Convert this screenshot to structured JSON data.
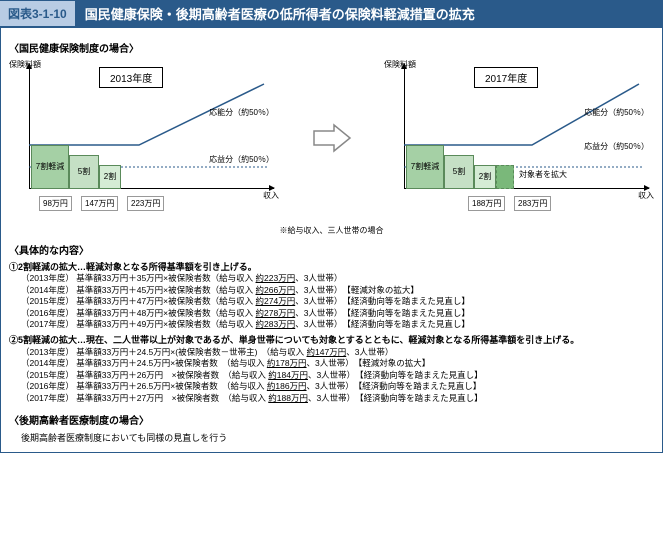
{
  "header": {
    "figNum": "図表3-1-10",
    "title": "国民健康保険・後期高齢者医療の低所得者の保険料軽減措置の拡充"
  },
  "section1": "〈国民健康保険制度の場合〉",
  "footnote": "※給与収入、三人世帯の場合",
  "chart_data": [
    {
      "type": "bar",
      "year": "2013年度",
      "ylabel": "保険料額",
      "xlabel": "収入",
      "notes": {
        "oneibun": "応能分（約50％）",
        "ouekibun": "応益分（約50％）"
      },
      "bars": [
        {
          "label": "7割軽減",
          "threshold": "98万円"
        },
        {
          "label": "5割",
          "threshold": "147万円"
        },
        {
          "label": "2割",
          "threshold": "223万円"
        }
      ]
    },
    {
      "type": "bar",
      "year": "2017年度",
      "ylabel": "保険料額",
      "xlabel": "収入",
      "notes": {
        "oneibun": "応能分（約50％）",
        "ouekibun": "応益分（約50％）",
        "expand": "対象者を拡大"
      },
      "bars": [
        {
          "label": "7割軽減"
        },
        {
          "label": "5割",
          "threshold": "188万円"
        },
        {
          "label": "2割",
          "threshold": "283万円",
          "extended": true
        }
      ]
    }
  ],
  "detailsTitle": "〈具体的な内容〉",
  "item1": {
    "head": "①2割軽減の拡大…軽減対象となる所得基準額を引き上げる。",
    "rows": [
      {
        "y": "（2013年度）",
        "f": "基準額33万円＋35万円×被保険者数（給与収入 約223万円、3人世帯）",
        "n": ""
      },
      {
        "y": "（2014年度）",
        "f": "基準額33万円＋45万円×被保険者数（給与収入 約266万円、3人世帯）",
        "n": "【軽減対象の拡大】"
      },
      {
        "y": "（2015年度）",
        "f": "基準額33万円＋47万円×被保険者数（給与収入 約274万円、3人世帯）",
        "n": "【経済動向等を踏まえた見直し】"
      },
      {
        "y": "（2016年度）",
        "f": "基準額33万円＋48万円×被保険者数（給与収入 約278万円、3人世帯）",
        "n": "【経済動向等を踏まえた見直し】"
      },
      {
        "y": "（2017年度）",
        "f": "基準額33万円＋49万円×被保険者数（給与収入 約283万円、3人世帯）",
        "n": "【経済動向等を踏まえた見直し】"
      }
    ]
  },
  "item2": {
    "head": "②5割軽減の拡大…現在、二人世帯以上が対象であるが、単身世帯についても対象とするとともに、軽減対象となる所得基準額を引き上げる。",
    "rows": [
      {
        "y": "（2013年度）",
        "f": "基準額33万円＋24.5万円×(被保険者数－世帯主)",
        "g": "（給与収入 約147万円、3人世帯）",
        "n": ""
      },
      {
        "y": "（2014年度）",
        "f": "基準額33万円＋24.5万円×被保険者数",
        "g": "（給与収入 約178万円、3人世帯）",
        "n": "【軽減対象の拡大】"
      },
      {
        "y": "（2015年度）",
        "f": "基準額33万円＋26万円　×被保険者数",
        "g": "（給与収入 約184万円、3人世帯）",
        "n": "【経済動向等を踏まえた見直し】"
      },
      {
        "y": "（2016年度）",
        "f": "基準額33万円＋26.5万円×被保険者数",
        "g": "（給与収入 約186万円、3人世帯）",
        "n": "【経済動向等を踏まえた見直し】"
      },
      {
        "y": "（2017年度）",
        "f": "基準額33万円＋27万円　×被保険者数",
        "g": "（給与収入 約188万円、3人世帯）",
        "n": "【経済動向等を踏まえた見直し】"
      }
    ]
  },
  "section2": {
    "title": "〈後期高齢者医療制度の場合〉",
    "text": "後期高齢者医療制度においても同様の見直しを行う"
  }
}
